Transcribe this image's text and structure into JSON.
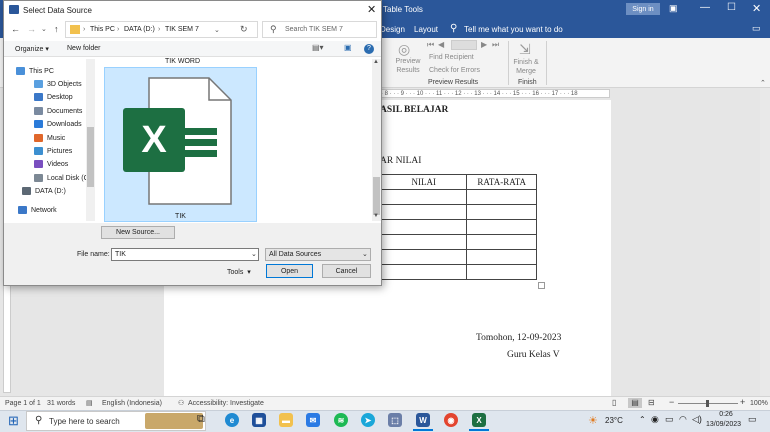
{
  "word": {
    "table_tools": "Table Tools",
    "sign_in": "Sign in",
    "tabs": [
      "Design",
      "Layout"
    ],
    "tell_me": "Tell me what you want to do",
    "ribbon": {
      "preview_results": "Preview Results",
      "find_recipient": "Find Recipient",
      "check_errors": "Check for Errors",
      "group_preview": "Preview Results",
      "finish_merge": "Finish & Merge",
      "group_finish": "Finish"
    },
    "ruler_text": "· 8 · · · 9 · · · 10 · · · 11 · · · 12 · · · 13 · · · 14 · · · 15 · · · 16 · · · 17 · · · 18",
    "document": {
      "heading": "ASIL BELAJAR",
      "subheading": "AR NILAI",
      "table_headers": [
        "NILAI",
        "RATA-RATA"
      ],
      "place_date": "Tomohon, 12-09-2023",
      "signature_line": "Guru Kelas V"
    },
    "status": {
      "page": "Page 1 of 1",
      "words": "31 words",
      "language": "English (Indonesia)",
      "accessibility": "Accessibility: Investigate",
      "zoom": "100%"
    }
  },
  "dialog": {
    "title": "Select Data Source",
    "breadcrumb": [
      "This PC",
      "DATA (D:)",
      "TIK SEM 7"
    ],
    "search_placeholder": "Search TIK SEM 7",
    "organize": "Organize",
    "new_folder": "New folder",
    "sidebar": [
      {
        "label": "This PC",
        "icon": "pc-icon",
        "color": "#4a90d9"
      },
      {
        "label": "3D Objects",
        "icon": "cube-icon",
        "color": "#5aa0e0"
      },
      {
        "label": "Desktop",
        "icon": "desktop-icon",
        "color": "#3b78c8"
      },
      {
        "label": "Documents",
        "icon": "document-icon",
        "color": "#7a8aa0"
      },
      {
        "label": "Downloads",
        "icon": "download-icon",
        "color": "#2b7bd9"
      },
      {
        "label": "Music",
        "icon": "music-icon",
        "color": "#e0672b"
      },
      {
        "label": "Pictures",
        "icon": "picture-icon",
        "color": "#3c8fd0"
      },
      {
        "label": "Videos",
        "icon": "video-icon",
        "color": "#7a4fc0"
      },
      {
        "label": "Local Disk (C:)",
        "icon": "disk-icon",
        "color": "#7c8894"
      },
      {
        "label": "DATA (D:)",
        "icon": "disk-icon",
        "color": "#5c6874"
      }
    ],
    "network": "Network",
    "file_above": "TIK WORD",
    "selected_file": "TIK",
    "new_source": "New Source...",
    "file_name_label": "File name:",
    "file_name_value": "TIK",
    "filter_value": "All Data Sources",
    "tools": "Tools",
    "open": "Open",
    "cancel": "Cancel"
  },
  "taskbar": {
    "search_placeholder": "Type here to search",
    "temperature": "23°C",
    "time": "0:26",
    "date": "13/09/2023"
  },
  "colors": {
    "word_blue": "#2b579a",
    "excel_green": "#1d6f42",
    "selection": "#cce8ff",
    "accent": "#0078d7"
  }
}
